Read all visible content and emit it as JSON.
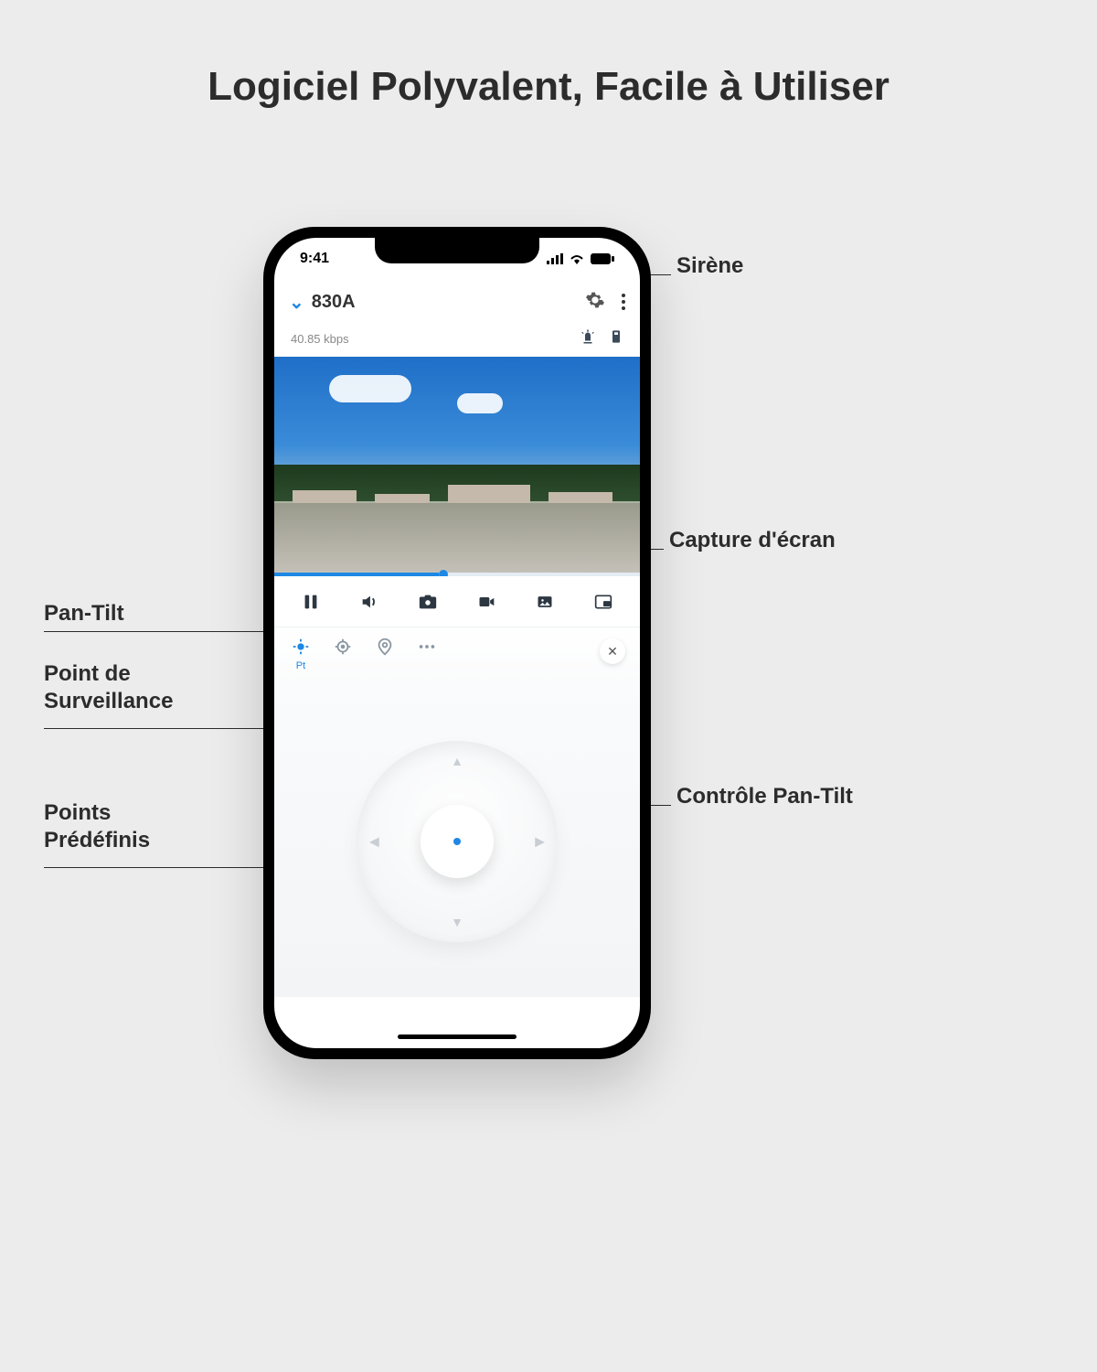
{
  "page_title": "Logiciel Polyvalent, Facile à Utiliser",
  "status": {
    "time": "9:41"
  },
  "app": {
    "camera_name": "830A",
    "bitrate": "40.85 kbps"
  },
  "secondary": {
    "pt_label": "Pt"
  },
  "callouts": {
    "siren": "Sirène",
    "screenshot": "Capture d'écran",
    "pan_tilt": "Pan-Tilt",
    "monitor_point": "Point de\nSurveillance",
    "preset_points": "Points\nPrédéfinis",
    "ptz_control": "Contrôle Pan-Tilt"
  }
}
